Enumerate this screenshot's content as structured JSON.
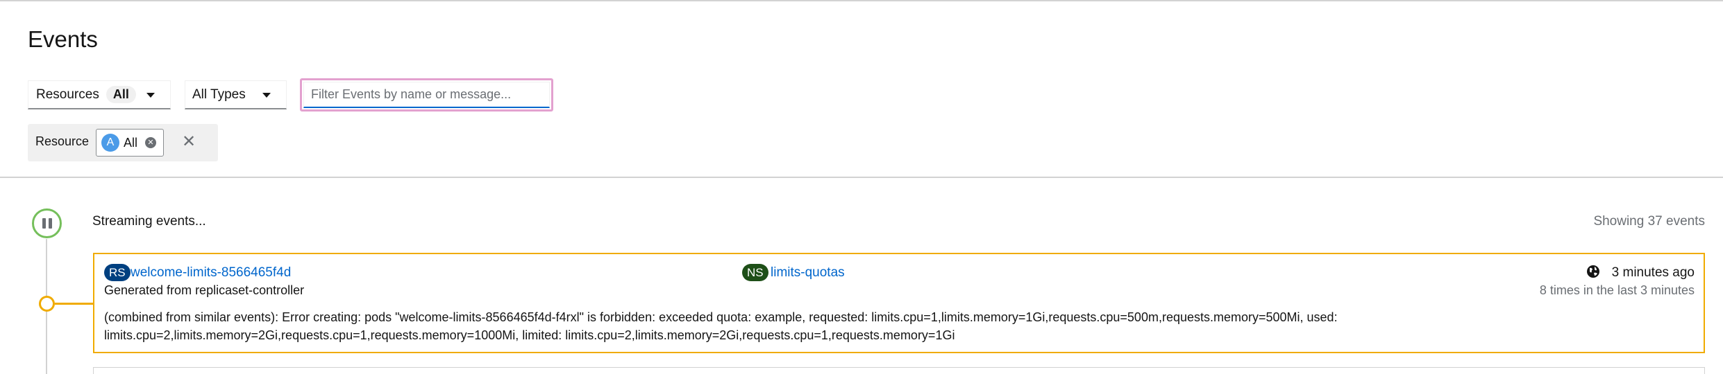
{
  "header": {
    "title": "Events"
  },
  "filters": {
    "resources_label": "Resources",
    "resources_count": "All",
    "types_label": "All Types",
    "search_placeholder": "Filter Events by name or message..."
  },
  "chip_group": {
    "label": "Resource",
    "chip_letter": "A",
    "chip_text": "All"
  },
  "stream": {
    "status": "Streaming events...",
    "count_text": "Showing 37 events"
  },
  "events": [
    {
      "resource_kind": "RS",
      "resource_name": "welcome-limits-8566465f4d",
      "namespace_kind": "NS",
      "namespace": "limits-quotas",
      "time": "3 minutes ago",
      "source": "Generated from replicaset-controller",
      "count": "8 times in the last 3 minutes",
      "message": "(combined from similar events): Error creating: pods \"welcome-limits-8566465f4d-f4rxl\" is forbidden: exceeded quota: example, requested: limits.cpu=1,limits.memory=1Gi,requests.cpu=500m,requests.memory=500Mi, used: limits.cpu=2,limits.memory=2Gi,requests.cpu=1,requests.memory=1000Mi, limited: limits.cpu=2,limits.memory=2Gi,requests.cpu=1,requests.memory=1Gi",
      "severity_color": "#f0ab00"
    }
  ],
  "colors": {
    "link": "#0066cc",
    "rs_badge": "#004080",
    "ns_badge": "#1e4f18",
    "warning": "#f0ab00",
    "streaming_ring": "#75bf5b",
    "focus_ring": "#e3a1cf"
  },
  "icons": {
    "pause": "pause-icon",
    "globe": "globe-icon",
    "chip_remove": "close-circle-icon",
    "chip_group_close": "close-icon",
    "dropdown": "caret-down-icon"
  }
}
